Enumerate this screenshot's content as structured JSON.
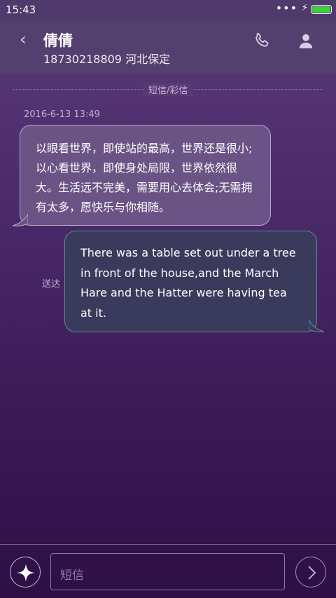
{
  "status_bar": {
    "time": "15:43",
    "signal_dots": "•••",
    "charging_glyph": "⚡",
    "battery_level": 1.0,
    "battery_color": "#3ecf3e"
  },
  "header": {
    "back_glyph": "‹",
    "contact_name": "倩倩",
    "contact_subtitle": "18730218809 河北保定",
    "icons": [
      "phone-icon",
      "contact-person-icon"
    ]
  },
  "conversation": {
    "channel_label": "短信/彩信",
    "timestamp": "2016-6-13 13:49",
    "messages": [
      {
        "direction": "incoming",
        "text": "以眼看世界，即使站的最高，世界还是很小;以心看世界，即使身处局限，世界依然很大。生活远不完美，需要用心去体会;无需拥有太多，愿快乐与你相随。"
      },
      {
        "direction": "outgoing",
        "status": "送达",
        "text": "There was a table set out under a tree in front of the house,and the March Hare and the Hatter were having tea at it."
      }
    ]
  },
  "composer": {
    "placeholder": "短信",
    "icons": [
      "sparkle-icon",
      "send-arrow-icon"
    ]
  },
  "colors": {
    "incoming_bubble": "#6b5385",
    "outgoing_bubble": "#3a3a5c",
    "outgoing_border": "#5e8b8e"
  }
}
